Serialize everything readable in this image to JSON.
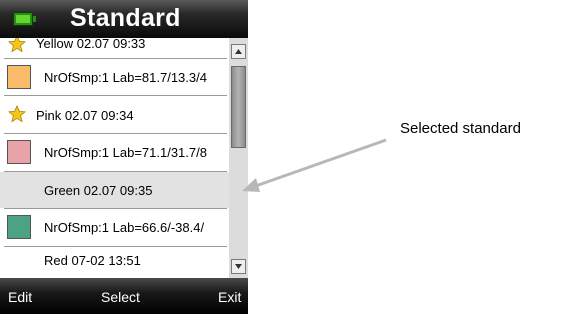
{
  "header": {
    "title": "Standard",
    "battery_icon": "battery-icon"
  },
  "list": {
    "items": [
      {
        "type": "name",
        "icon": "star-icon",
        "label": "Yellow 02.07 09:33"
      },
      {
        "type": "sample",
        "swatch_color": "#f8bc6a",
        "label": "NrOfSmp:1 Lab=81.7/13.3/4"
      },
      {
        "type": "name",
        "icon": "star-icon",
        "label": "Pink 02.07 09:34"
      },
      {
        "type": "sample",
        "swatch_color": "#e8a3a8",
        "label": "NrOfSmp:1 Lab=71.1/31.7/8"
      },
      {
        "type": "name",
        "selected": true,
        "label": "Green 02.07 09:35"
      },
      {
        "type": "sample",
        "swatch_color": "#4aa383",
        "label": "NrOfSmp:1 Lab=66.6/-38.4/"
      },
      {
        "type": "name",
        "label": "Red 07-02 13:51"
      }
    ]
  },
  "softkeys": {
    "left": "Edit",
    "center": "Select",
    "right": "Exit"
  },
  "annotation": {
    "text": "Selected standard"
  },
  "colors": {
    "star": "#f5c518",
    "selected_row": "#e2e2e2",
    "arrow": "#b8b8b8"
  }
}
